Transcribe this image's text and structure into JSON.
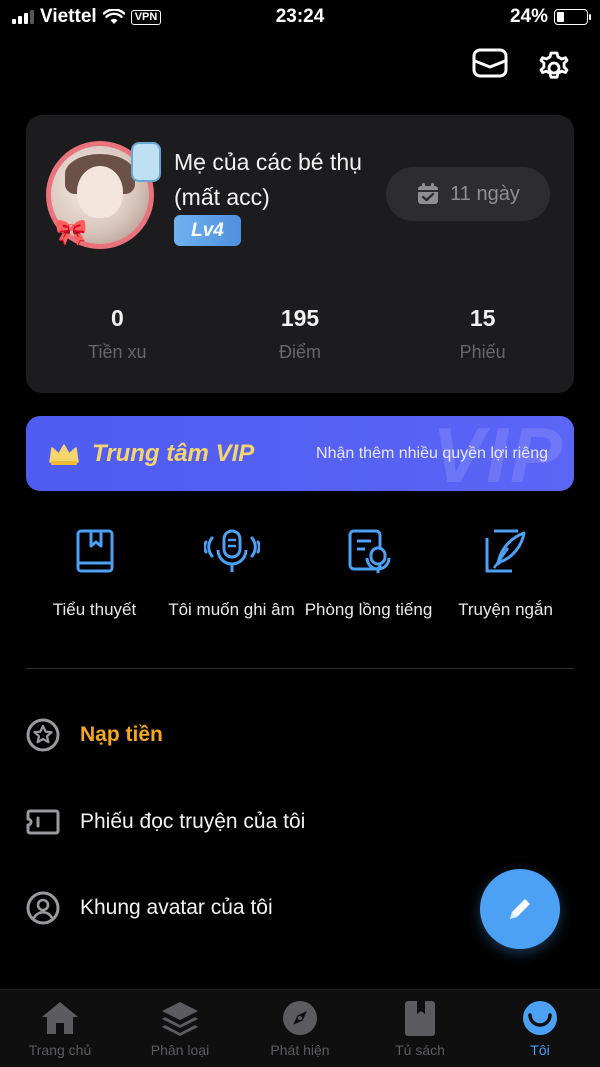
{
  "status_bar": {
    "carrier": "Viettel",
    "vpn": "VPN",
    "time": "23:24",
    "battery_percent": "24%",
    "battery_level": 0.24,
    "signal_bars": 3
  },
  "top_icons": [
    "mail-icon",
    "gear-icon"
  ],
  "profile": {
    "username": "Mẹ của các bé thụ (mất acc)",
    "level": "Lv4",
    "checkin_days": "11 ngày",
    "stats": [
      {
        "value": "0",
        "label": "Tiền xu"
      },
      {
        "value": "195",
        "label": "Điểm"
      },
      {
        "value": "15",
        "label": "Phiếu"
      }
    ]
  },
  "vip": {
    "title": "Trung tâm VIP",
    "subtitle": "Nhận thêm nhiều quyền lợi riêng",
    "watermark": "VIP",
    "accent_color": "#f5d66d",
    "background_color": "#5561f4"
  },
  "features": [
    {
      "label": "Tiểu thuyết",
      "icon": "book-icon"
    },
    {
      "label": "Tôi muốn ghi âm",
      "icon": "microphone-icon"
    },
    {
      "label": "Phòng lồng tiếng",
      "icon": "dubbing-room-icon"
    },
    {
      "label": "Truyện ngắn",
      "icon": "feather-pen-icon"
    }
  ],
  "menu": [
    {
      "label": "Nạp tiền",
      "icon": "star-circle-icon",
      "highlight": true
    },
    {
      "label": "Phiếu đọc truyện của tôi",
      "icon": "ticket-icon"
    },
    {
      "label": "Khung avatar của tôi",
      "icon": "user-circle-icon"
    }
  ],
  "bottom_nav": [
    {
      "label": "Trang chủ",
      "icon": "home-icon"
    },
    {
      "label": "Phân loại",
      "icon": "layers-icon"
    },
    {
      "label": "Phát hiện",
      "icon": "compass-icon"
    },
    {
      "label": "Tủ sách",
      "icon": "bookshelf-icon"
    },
    {
      "label": "Tôi",
      "icon": "smile-icon",
      "active": true
    }
  ],
  "colors": {
    "accent_blue": "#4da1f4",
    "highlight_orange": "#f5a623",
    "card_bg": "#1c1c1e"
  }
}
